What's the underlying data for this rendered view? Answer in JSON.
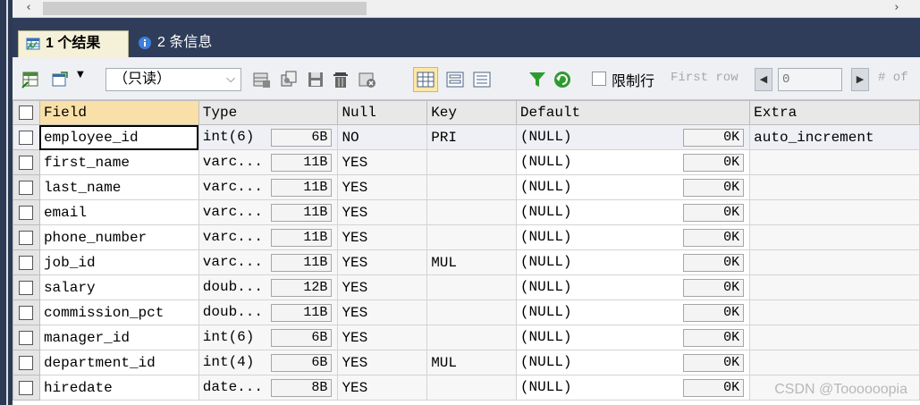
{
  "scrollbar": {
    "left_arrow": "‹",
    "right_arrow": "›"
  },
  "tabs": [
    {
      "label": "1 个结果",
      "active": true,
      "icon": "table-result-icon"
    },
    {
      "label": "2 条信息",
      "active": false,
      "icon": "info-icon"
    }
  ],
  "toolbar": {
    "mode_select": {
      "value": "（只读）",
      "caret": "⌵"
    },
    "limit_rows_label": "限制行",
    "first_row_label": "First row",
    "first_row_value": "0",
    "prev_label": "◀",
    "next_label": "▶",
    "rows_label": "# of"
  },
  "grid": {
    "columns": [
      "Field",
      "Type",
      "Null",
      "Key",
      "Default",
      "Extra"
    ],
    "rows": [
      {
        "field": "employee_id",
        "type": "int(6)",
        "size": "6B",
        "null": "NO",
        "key": "PRI",
        "default": "(NULL)",
        "default_size": "0K",
        "extra": "auto_increment"
      },
      {
        "field": "first_name",
        "type": "varc...",
        "size": "11B",
        "null": "YES",
        "key": "",
        "default": "(NULL)",
        "default_size": "0K",
        "extra": ""
      },
      {
        "field": "last_name",
        "type": "varc...",
        "size": "11B",
        "null": "YES",
        "key": "",
        "default": "(NULL)",
        "default_size": "0K",
        "extra": ""
      },
      {
        "field": "email",
        "type": "varc...",
        "size": "11B",
        "null": "YES",
        "key": "",
        "default": "(NULL)",
        "default_size": "0K",
        "extra": ""
      },
      {
        "field": "phone_number",
        "type": "varc...",
        "size": "11B",
        "null": "YES",
        "key": "",
        "default": "(NULL)",
        "default_size": "0K",
        "extra": ""
      },
      {
        "field": "job_id",
        "type": "varc...",
        "size": "11B",
        "null": "YES",
        "key": "MUL",
        "default": "(NULL)",
        "default_size": "0K",
        "extra": ""
      },
      {
        "field": "salary",
        "type": "doub...",
        "size": "12B",
        "null": "YES",
        "key": "",
        "default": "(NULL)",
        "default_size": "0K",
        "extra": ""
      },
      {
        "field": "commission_pct",
        "type": "doub...",
        "size": "11B",
        "null": "YES",
        "key": "",
        "default": "(NULL)",
        "default_size": "0K",
        "extra": ""
      },
      {
        "field": "manager_id",
        "type": "int(6)",
        "size": "6B",
        "null": "YES",
        "key": "",
        "default": "(NULL)",
        "default_size": "0K",
        "extra": ""
      },
      {
        "field": "department_id",
        "type": "int(4)",
        "size": "6B",
        "null": "YES",
        "key": "MUL",
        "default": "(NULL)",
        "default_size": "0K",
        "extra": ""
      },
      {
        "field": "hiredate",
        "type": "date...",
        "size": "8B",
        "null": "YES",
        "key": "",
        "default": "(NULL)",
        "default_size": "0K",
        "extra": ""
      }
    ]
  },
  "watermark": "CSDN @Toooooopia",
  "colors": {
    "tab_bar": "#2f3d5b",
    "active_tab": "#f5f0d8",
    "header_highlight": "#f9e0a8",
    "selected_view": "#ffe8a6"
  }
}
